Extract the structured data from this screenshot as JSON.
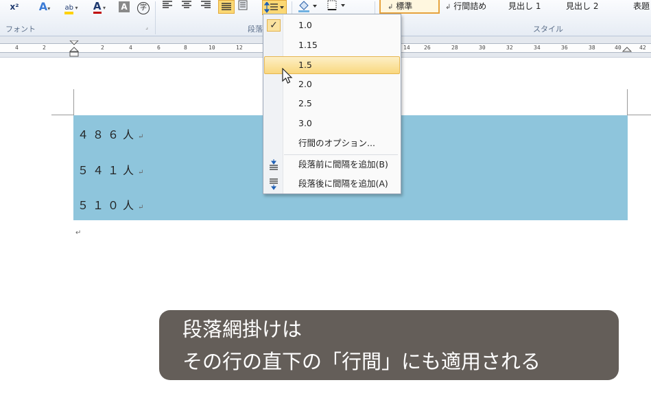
{
  "ribbon": {
    "font_buttons": [
      "x²",
      "A",
      "ab",
      "A",
      "A",
      "字"
    ],
    "group_font": "フォント",
    "group_paragraph": "段落",
    "group_style": "スタイル",
    "styles": [
      "標準",
      "行間詰め",
      "見出し 1",
      "見出し 2",
      "表題"
    ],
    "style_marker": "↲",
    "highlight_color": "#ffd200",
    "font_color": "#c00000"
  },
  "ruler": {
    "ticks": [
      "4",
      "2",
      "2",
      "4",
      "6",
      "8",
      "10",
      "12",
      "14",
      "26",
      "28",
      "30",
      "32",
      "34",
      "36",
      "38",
      "40",
      "42"
    ]
  },
  "document": {
    "lines": [
      "４８６人",
      "５４１人",
      "５１０人"
    ],
    "paragraph_mark": "↵",
    "shading_color": "#8ec5dc"
  },
  "line_spacing_menu": {
    "checked_value": "1.0",
    "highlighted_value": "1.5",
    "options": [
      "1.0",
      "1.15",
      "1.5",
      "2.0",
      "2.5",
      "3.0"
    ],
    "options_item": "行間のオプション...",
    "add_space_before": "段落前に間隔を追加(B)",
    "add_space_after": "段落後に間隔を追加(A)",
    "check_glyph": "✓"
  },
  "caption": {
    "line1": "段落網掛けは",
    "line2": "その行の直下の「行間」にも適用される"
  }
}
